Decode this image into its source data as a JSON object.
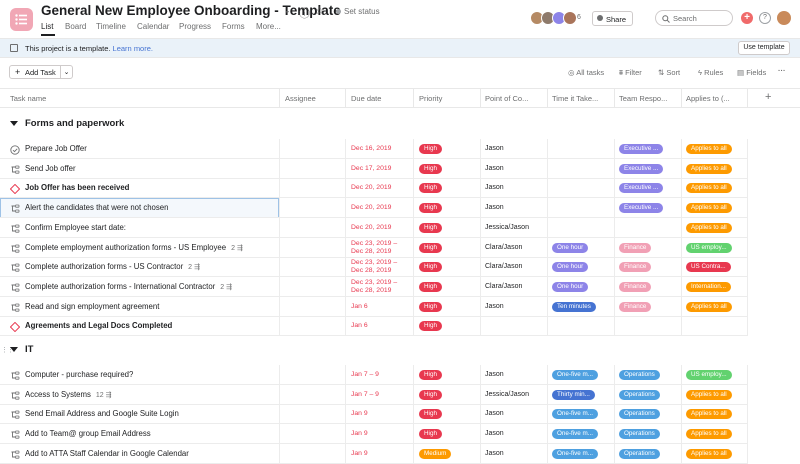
{
  "header": {
    "title": "General New Employee Onboarding - Template",
    "set_status": "Set status",
    "avatar_extra_count": "6",
    "share_label": "Share",
    "search_placeholder": "Search"
  },
  "nav_tabs": [
    {
      "label": "List",
      "active": true
    },
    {
      "label": "Board"
    },
    {
      "label": "Timeline"
    },
    {
      "label": "Calendar"
    },
    {
      "label": "Progress"
    },
    {
      "label": "Forms"
    },
    {
      "label": "More..."
    }
  ],
  "banner": {
    "text": "This project is a template.",
    "link": "Learn more.",
    "button": "Use template"
  },
  "toolbar": {
    "add_task": "Add Task",
    "all_tasks": "All tasks",
    "filter": "Filter",
    "sort": "Sort",
    "rules": "Rules",
    "fields": "Fields"
  },
  "columns": [
    "Task name",
    "Assignee",
    "Due date",
    "Priority",
    "Point of Co...",
    "Time it Take...",
    "Team Respo...",
    "Applies to (..."
  ],
  "colors": {
    "high": "#e8384f",
    "medium": "#fd9a00",
    "exec": "#8d84e8",
    "applies_all": "#fd9a00",
    "one_hour": "#8d84e8",
    "ten_min": "#4573d2",
    "one_five": "#4ea0e0",
    "thirty": "#4573d2",
    "finance": "#f1a0b5",
    "operations": "#4ea0e0",
    "us_employ": "#62d26f",
    "us_contra": "#e8384f",
    "international": "#fd9a00"
  },
  "sections": [
    {
      "title": "Forms and paperwork",
      "tasks": [
        {
          "name": "Prepare Job Offer",
          "icon": "check-circle",
          "date": [
            "Dec 16, 2019"
          ],
          "priority": "High",
          "poc": "Jason",
          "team": "Executive ...",
          "team_color": "exec",
          "applies": "Applies to all"
        },
        {
          "name": "Send Job offer",
          "icon": "subtask",
          "date": [
            "Dec 17, 2019"
          ],
          "priority": "High",
          "poc": "Jason",
          "team": "Executive ...",
          "team_color": "exec",
          "applies": "Applies to all"
        },
        {
          "name": "Job Offer has been received",
          "icon": "milestone",
          "bold": true,
          "date": [
            "Dec 20, 2019"
          ],
          "priority": "High",
          "poc": "Jason",
          "team": "Executive ...",
          "team_color": "exec",
          "applies": "Applies to all"
        },
        {
          "name": "Alert the candidates that were not chosen",
          "icon": "subtask",
          "selected": true,
          "date": [
            "Dec 20, 2019"
          ],
          "priority": "High",
          "poc": "Jason",
          "team": "Executive ...",
          "team_color": "exec",
          "applies": "Applies to all"
        },
        {
          "name": "Confirm Employee start date:",
          "icon": "subtask",
          "date": [
            "Dec 20, 2019"
          ],
          "priority": "High",
          "poc": "Jessica/Jason",
          "applies": "Applies to all"
        },
        {
          "name": "Complete employment authorization forms - US Employee",
          "icon": "subtask",
          "subtasks": "2",
          "date": [
            "Dec 23, 2019 –",
            "Dec 28, 2019"
          ],
          "priority": "High",
          "poc": "Clara/Jason",
          "time": "One hour",
          "time_color": "one_hour",
          "team": "Finance",
          "team_color": "finance",
          "applies": "US employ...",
          "applies_color": "us_employ"
        },
        {
          "name": "Complete authorization forms - US Contractor",
          "icon": "subtask",
          "subtasks": "2",
          "date": [
            "Dec 23, 2019 –",
            "Dec 28, 2019"
          ],
          "priority": "High",
          "poc": "Clara/Jason",
          "time": "One hour",
          "time_color": "one_hour",
          "team": "Finance",
          "team_color": "finance",
          "applies": "US Contra...",
          "applies_color": "us_contra"
        },
        {
          "name": "Complete authorization forms - International Contractor",
          "icon": "subtask",
          "subtasks": "2",
          "date": [
            "Dec 23, 2019 –",
            "Dec 28, 2019"
          ],
          "priority": "High",
          "poc": "Clara/Jason",
          "time": "One hour",
          "time_color": "one_hour",
          "team": "Finance",
          "team_color": "finance",
          "applies": "Internation...",
          "applies_color": "international"
        },
        {
          "name": "Read and sign employment agreement",
          "icon": "subtask",
          "date": [
            "Jan 6"
          ],
          "priority": "High",
          "poc": "Jason",
          "time": "Ten minutes",
          "time_color": "ten_min",
          "team": "Finance",
          "team_color": "finance",
          "applies": "Applies to all"
        },
        {
          "name": "Agreements and Legal Docs Completed",
          "icon": "milestone",
          "bold": true,
          "date": [
            "Jan 6"
          ],
          "priority": "High"
        }
      ]
    },
    {
      "title": "IT",
      "tasks": [
        {
          "name": "Computer - purchase required?",
          "icon": "subtask",
          "date": [
            "Jan 7 – 9"
          ],
          "priority": "High",
          "poc": "Jason",
          "time": "One-five m...",
          "time_color": "one_five",
          "team": "Operations",
          "team_color": "operations",
          "applies": "US employ...",
          "applies_color": "us_employ"
        },
        {
          "name": "Access to Systems",
          "icon": "subtask",
          "subtasks": "12",
          "date": [
            "Jan 7 – 9"
          ],
          "priority": "High",
          "poc": "Jessica/Jason",
          "time": "Thirty min...",
          "time_color": "thirty",
          "team": "Operations",
          "team_color": "operations",
          "applies": "Applies to all"
        },
        {
          "name": "Send Email Address and Google Suite Login",
          "icon": "subtask",
          "date": [
            "Jan 9"
          ],
          "priority": "High",
          "poc": "Jason",
          "time": "One-five m...",
          "time_color": "one_five",
          "team": "Operations",
          "team_color": "operations",
          "applies": "Applies to all"
        },
        {
          "name": "Add to Team@ group Email Address",
          "icon": "subtask",
          "date": [
            "Jan 9"
          ],
          "priority": "High",
          "poc": "Jason",
          "time": "One-five m...",
          "time_color": "one_five",
          "team": "Operations",
          "team_color": "operations",
          "applies": "Applies to all"
        },
        {
          "name": "Add to ATTA Staff Calendar in Google Calendar",
          "icon": "subtask",
          "date": [
            "Jan 9"
          ],
          "priority": "Medium",
          "poc": "Jason",
          "time": "One-five m...",
          "time_color": "one_five",
          "team": "Operations",
          "team_color": "operations",
          "applies": "Applies to all"
        }
      ]
    }
  ]
}
